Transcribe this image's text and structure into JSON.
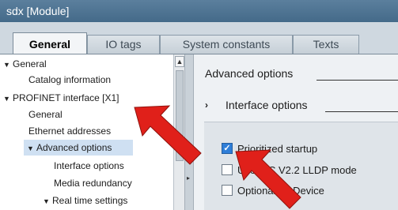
{
  "window": {
    "title": "sdx [Module]"
  },
  "tabs": [
    {
      "label": "General",
      "active": true
    },
    {
      "label": "IO tags",
      "active": false
    },
    {
      "label": "System constants",
      "active": false
    },
    {
      "label": "Texts",
      "active": false
    }
  ],
  "tree": {
    "items": [
      {
        "label": "General",
        "expanded": true
      },
      {
        "label": "Catalog information"
      },
      {
        "label": "PROFINET interface [X1]",
        "expanded": true
      },
      {
        "label": "General"
      },
      {
        "label": "Ethernet addresses"
      },
      {
        "label": "Advanced options",
        "expanded": true,
        "selected": true
      },
      {
        "label": "Interface options"
      },
      {
        "label": "Media redundancy"
      },
      {
        "label": "Real time settings",
        "expanded": true
      }
    ]
  },
  "panel": {
    "section_title": "Advanced options",
    "subsection_marker": "›",
    "subsection_title": "Interface options",
    "checkboxes": [
      {
        "label": "Prioritized startup",
        "checked": true
      },
      {
        "label": "Use IEC V2.2 LLDP mode",
        "checked": false
      },
      {
        "label": "Optional IO-Device",
        "checked": false
      }
    ]
  },
  "colors": {
    "annotation_arrow": "#e0201a",
    "selection": "#cfe0f2",
    "checkbox_checked": "#2f7ed8"
  },
  "icons": {
    "expand": "triangle-down-icon",
    "scroll_up": "scroll-up-arrow-icon",
    "splitter": "splitter-arrow-icon",
    "annotation": "red-arrow-icon"
  }
}
